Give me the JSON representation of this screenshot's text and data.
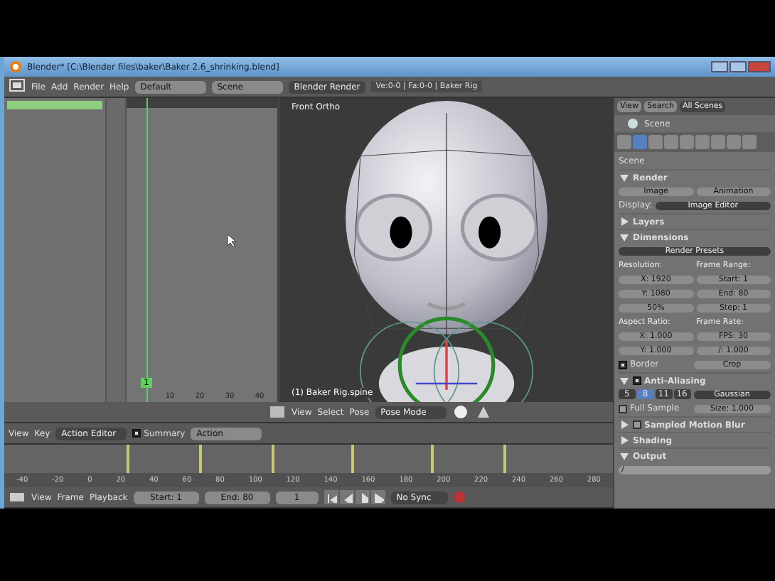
{
  "window": {
    "title": "Blender* [C:\\Blender files\\baker\\Baker 2.6_shrinking.blend]"
  },
  "info_header": {
    "menus": [
      "File",
      "Add",
      "Render",
      "Help"
    ],
    "layout": "Default",
    "scene": "Scene",
    "engine": "Blender Render",
    "stats": "Ve:0-0 | Fa:0-0 | Baker Rig"
  },
  "outliner": {
    "view": "View",
    "search": "Search",
    "filter": "All Scenes",
    "item": "Scene"
  },
  "action_channels": [
    {
      "selected": true
    }
  ],
  "graph_ruler": [
    "10",
    "20",
    "30",
    "40"
  ],
  "current_frame": "1",
  "viewport": {
    "view_name": "Front Ortho",
    "object_info": "(1) Baker Rig.spine",
    "menus": [
      "View",
      "Select",
      "Pose"
    ],
    "mode": "Pose Mode"
  },
  "dopesheet_header": {
    "menus": [
      "View",
      "Key"
    ],
    "mode": "Action Editor",
    "summary": "Summary",
    "summary_checked": true,
    "action": "Action"
  },
  "timeline_ruler": [
    "-40",
    "-20",
    "0",
    "20",
    "40",
    "60",
    "80",
    "100",
    "120",
    "140",
    "160",
    "180",
    "200",
    "220",
    "240",
    "260",
    "280"
  ],
  "timeline_header": {
    "menus": [
      "View",
      "Frame",
      "Playback"
    ],
    "start": "Start: 1",
    "end": "End: 80",
    "frame": "1",
    "sync": "No Sync"
  },
  "property_tabs": [
    {
      "selected": false
    },
    {
      "selected": true
    },
    {
      "selected": false
    },
    {
      "selected": false
    },
    {
      "selected": false
    },
    {
      "selected": false
    },
    {
      "selected": false
    },
    {
      "selected": false
    },
    {
      "selected": false
    }
  ],
  "properties": [
    {
      "kind": "crumb",
      "label": "Scene"
    },
    {
      "kind": "panel",
      "label": "Render",
      "expanded": true
    },
    {
      "kind": "pair",
      "items": [
        "Image",
        "Animation"
      ]
    },
    {
      "kind": "select",
      "label": "Display:",
      "value": "Image Editor"
    },
    {
      "kind": "panel",
      "label": "Layers",
      "expanded": false
    },
    {
      "kind": "panel",
      "label": "Dimensions",
      "expanded": true
    },
    {
      "kind": "select",
      "value": "Render Presets"
    },
    {
      "kind": "heads",
      "items": [
        "Resolution:",
        "Frame Range:"
      ]
    },
    {
      "kind": "pair",
      "items": [
        "X: 1920",
        "Start: 1"
      ]
    },
    {
      "kind": "pair",
      "items": [
        "Y: 1080",
        "End: 80"
      ]
    },
    {
      "kind": "pair",
      "items": [
        "50%",
        "Step: 1"
      ]
    },
    {
      "kind": "heads",
      "items": [
        "Aspect Ratio:",
        "Frame Rate:"
      ]
    },
    {
      "kind": "pair",
      "items": [
        "X: 1.000",
        "FPS: 30"
      ]
    },
    {
      "kind": "pair",
      "items": [
        "Y: 1.000",
        "/: 1.000"
      ]
    },
    {
      "kind": "check",
      "label": "Border",
      "checked": true,
      "extra": "Crop"
    },
    {
      "kind": "panel",
      "label": "Anti-Aliasing",
      "expanded": true,
      "checked": true
    },
    {
      "kind": "aa",
      "items": [
        {
          "label": "5",
          "selected": false
        },
        {
          "label": "8",
          "selected": true
        },
        {
          "label": "11",
          "selected": false
        },
        {
          "label": "16",
          "selected": false
        }
      ],
      "filter": "Gaussian"
    },
    {
      "kind": "check",
      "label": "Full Sample",
      "checked": false,
      "extra": "Size: 1.000"
    },
    {
      "kind": "panel",
      "label": "Sampled Motion Blur",
      "expanded": false,
      "checked": false
    },
    {
      "kind": "panel",
      "label": "Shading",
      "expanded": false
    },
    {
      "kind": "panel",
      "label": "Output",
      "expanded": true
    },
    {
      "kind": "path",
      "value": "/"
    }
  ]
}
